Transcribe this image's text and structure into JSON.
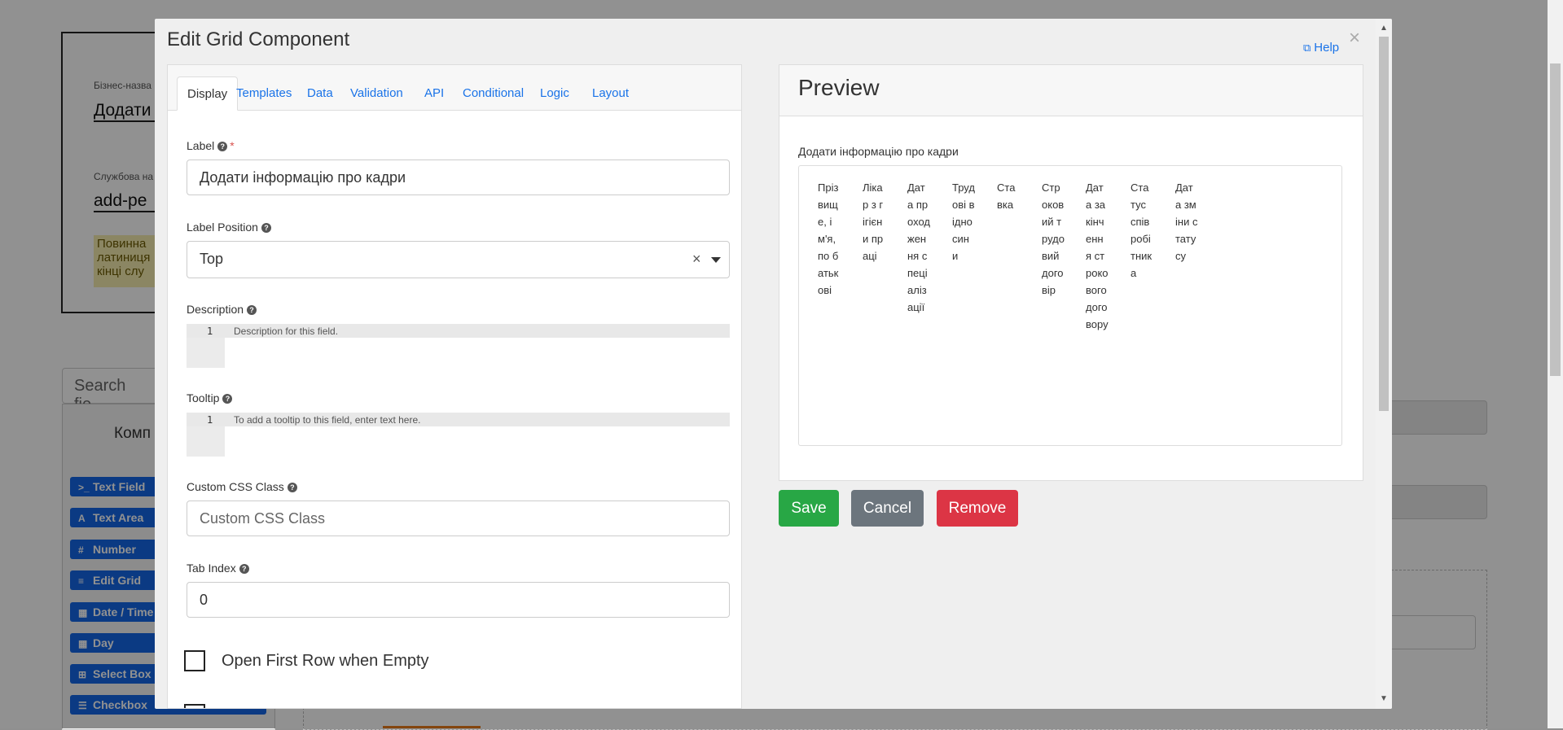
{
  "background": {
    "business_name_label": "Бізнес-назва",
    "business_name_value": "Додати",
    "service_name_label": "Службова на",
    "service_name_value": "add-pe",
    "note_text": "Повинна латиниця кінці слу",
    "search_placeholder": "Search fie",
    "components_title": "Комп",
    "components": [
      {
        "icon": ">_",
        "label": "Text Field"
      },
      {
        "icon": "A",
        "label": "Text Area"
      },
      {
        "icon": "#",
        "label": "Number"
      },
      {
        "icon": "≡",
        "label": "Edit Grid"
      },
      {
        "icon": "▦",
        "label": "Date / Time"
      },
      {
        "icon": "▦",
        "label": "Day"
      },
      {
        "icon": "⊞",
        "label": "Select Box"
      },
      {
        "icon": "☰",
        "label": "Checkbox"
      }
    ]
  },
  "modal": {
    "title": "Edit Grid Component",
    "help_label": "Help",
    "close_glyph": "×",
    "tabs": [
      "Display",
      "Templates",
      "Data",
      "Validation",
      "API",
      "Conditional",
      "Logic",
      "Layout"
    ],
    "fields": {
      "label": {
        "label": "Label",
        "required_mark": "*",
        "value": "Додати інформацію про кадри"
      },
      "label_position": {
        "label": "Label Position",
        "value": "Top",
        "clear_glyph": "×"
      },
      "description": {
        "label": "Description",
        "line_number": "1",
        "placeholder": "Description for this field."
      },
      "tooltip": {
        "label": "Tooltip",
        "line_number": "1",
        "placeholder": "To add a tooltip to this field, enter text here."
      },
      "custom_css": {
        "label": "Custom CSS Class",
        "placeholder": "Custom CSS Class"
      },
      "tab_index": {
        "label": "Tab Index",
        "value": "0"
      },
      "open_first_row": {
        "label": "Open First Row when Empty"
      }
    }
  },
  "preview": {
    "title": "Preview",
    "grid_label": "Додати інформацію про кадри",
    "columns": [
      "Прізвище, ім'я, по батькові",
      "Лікар з гігієни праці",
      "Дата проходження спеціалізації",
      "Трудові відносини",
      "Ставка",
      "Строковий трудовий договір",
      "Дата закінчення строкового договору",
      "Статус співробітника",
      "Дата зміни статусу"
    ]
  },
  "actions": {
    "save": "Save",
    "cancel": "Cancel",
    "remove": "Remove"
  },
  "colors": {
    "link": "#1a73e8",
    "save": "#28a745",
    "cancel": "#6c757d",
    "remove": "#dc3545",
    "component_button": "#1467e6"
  }
}
